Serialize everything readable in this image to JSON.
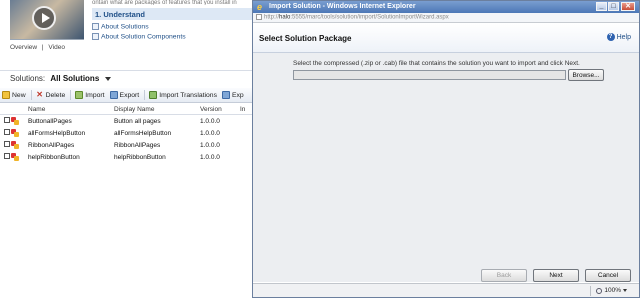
{
  "crm": {
    "top_line": "ontain what are packages of features that you install in",
    "thumb_links": [
      "Overview",
      "|",
      "Video"
    ],
    "understand_label": "1. Understand",
    "about_links": [
      "About Solutions",
      "About Solution Components"
    ],
    "solutions_label": "Solutions:",
    "solutions_view": "All Solutions",
    "toolbar": {
      "new": "New",
      "delete": "Delete",
      "import": "Import",
      "export": "Export",
      "import_translations": "Import Translations",
      "export_translations": "Exp"
    },
    "grid": {
      "columns": [
        "Name",
        "Display Name",
        "Version",
        "In"
      ],
      "rows": [
        {
          "name": "ButtonallPages",
          "display": "Button all pages",
          "version": "1.0.0.0"
        },
        {
          "name": "allFormsHelpButton",
          "display": "allFormsHelpButton",
          "version": "1.0.0.0"
        },
        {
          "name": "RibbonAllPages",
          "display": "RibbonAllPages",
          "version": "1.0.0.0"
        },
        {
          "name": "helpRibbonButton",
          "display": "helpRibbonButton",
          "version": "1.0.0.0"
        }
      ]
    }
  },
  "dialog": {
    "window_title": "Import Solution - Windows Internet Explorer",
    "address_prefix": "http://",
    "address_host": "halo",
    "address_rest": ":5555/marc/tools/solution/import/SolutionImportWizard.aspx",
    "heading": "Select Solution Package",
    "help_label": "Help",
    "instruction": "Select the compressed (.zip or .cab) file that contains the solution you want to import and click Next.",
    "file_value": "",
    "browse_label": "Browse...",
    "back_label": "Back",
    "next_label": "Next",
    "cancel_label": "Cancel",
    "zoom_label": "100%"
  },
  "colors": {
    "titlebar": "#4c77b6",
    "link": "#1f4f87",
    "header_band": "#dde8f5"
  }
}
